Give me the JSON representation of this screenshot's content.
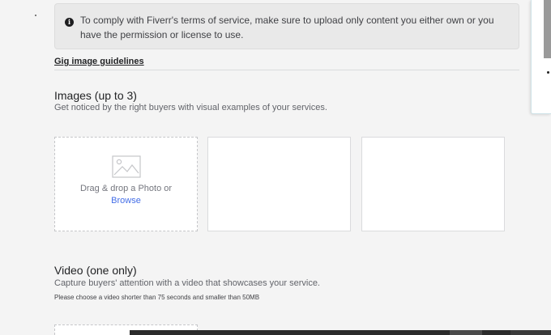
{
  "notice": {
    "icon": "info-icon",
    "text": "To comply with Fiverr's terms of service, make sure to upload only content you either own or you have the permission or license to use."
  },
  "guidelines_link": "Gig image guidelines",
  "images_section": {
    "title": "Images (up to 3)",
    "subtitle": "Get noticed by the right buyers with visual examples of your services.",
    "upload_slot": {
      "icon": "photo-icon",
      "drag_text": "Drag & drop a Photo or",
      "browse_label": "Browse"
    }
  },
  "video_section": {
    "title": "Video (one only)",
    "subtitle": "Capture buyers' attention with a video that showcases your service.",
    "note": "Please choose a video shorter than 75 seconds and smaller than 50MB"
  },
  "colors": {
    "link": "#446ee7",
    "page_background": "#f4f4f4",
    "notice_background": "#e9e9e9"
  }
}
